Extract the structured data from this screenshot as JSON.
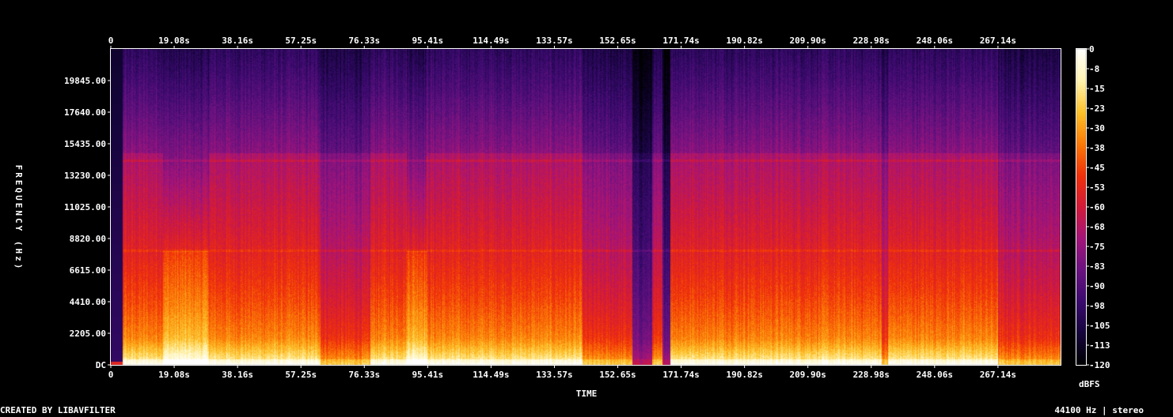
{
  "chart_data": {
    "type": "heatmap",
    "title": "",
    "xlabel": "TIME",
    "ylabel": "FREQUENCY (Hz)",
    "x_ticks": [
      "0",
      "19.08s",
      "38.16s",
      "57.25s",
      "76.33s",
      "95.41s",
      "114.49s",
      "133.57s",
      "152.65s",
      "171.74s",
      "190.82s",
      "209.90s",
      "228.98s",
      "248.06s",
      "267.14s"
    ],
    "x_tick_values": [
      0,
      19.08,
      38.16,
      57.25,
      76.33,
      95.41,
      114.49,
      133.57,
      152.65,
      171.74,
      190.82,
      209.9,
      228.98,
      248.06,
      267.14
    ],
    "xlim": [
      0,
      286
    ],
    "y_ticks": [
      "DC",
      "2205.00",
      "4410.00",
      "6615.00",
      "8820.00",
      "11025.00",
      "13230.00",
      "15435.00",
      "17640.00",
      "19845.00"
    ],
    "y_tick_values": [
      0,
      2205,
      4410,
      6615,
      8820,
      11025,
      13230,
      15435,
      17640,
      19845
    ],
    "ylim": [
      0,
      22050
    ],
    "colorbar": {
      "label": "dBFS",
      "ticks": [
        "0",
        "-8",
        "-15",
        "-23",
        "-30",
        "-38",
        "-45",
        "-53",
        "-60",
        "-68",
        "-75",
        "-83",
        "-90",
        "-98",
        "-105",
        "-113",
        "-120"
      ],
      "range": [
        -120,
        0
      ],
      "colors": [
        "#000000",
        "#14043a",
        "#3a0a6e",
        "#6a1280",
        "#a3147a",
        "#d21a3a",
        "#f0300a",
        "#fb7a06",
        "#fdc22a",
        "#fff3b0",
        "#ffffff"
      ]
    },
    "segments": [
      {
        "t": [
          0,
          3.5
        ],
        "level": "silence"
      },
      {
        "t": [
          3.5,
          15.5
        ],
        "level": "loud"
      },
      {
        "t": [
          15.5,
          29.5
        ],
        "level": "bright"
      },
      {
        "t": [
          29.5,
          63
        ],
        "level": "loud"
      },
      {
        "t": [
          63,
          78
        ],
        "level": "medium"
      },
      {
        "t": [
          78,
          89
        ],
        "level": "loud"
      },
      {
        "t": [
          89,
          95
        ],
        "level": "bright"
      },
      {
        "t": [
          95,
          142
        ],
        "level": "loud"
      },
      {
        "t": [
          142,
          157
        ],
        "level": "medium"
      },
      {
        "t": [
          157,
          163
        ],
        "level": "quiet"
      },
      {
        "t": [
          163,
          166
        ],
        "level": "medium"
      },
      {
        "t": [
          166,
          168.5
        ],
        "level": "quiet"
      },
      {
        "t": [
          168.5,
          232
        ],
        "level": "loud"
      },
      {
        "t": [
          232,
          234
        ],
        "level": "medium"
      },
      {
        "t": [
          234,
          267
        ],
        "level": "loud"
      },
      {
        "t": [
          267,
          286
        ],
        "level": "medium"
      }
    ],
    "tonal_lines_hz": [
      14300,
      8000
    ]
  },
  "footer": {
    "left": "CREATED BY LIBAVFILTER",
    "right": "44100 Hz | stereo"
  }
}
